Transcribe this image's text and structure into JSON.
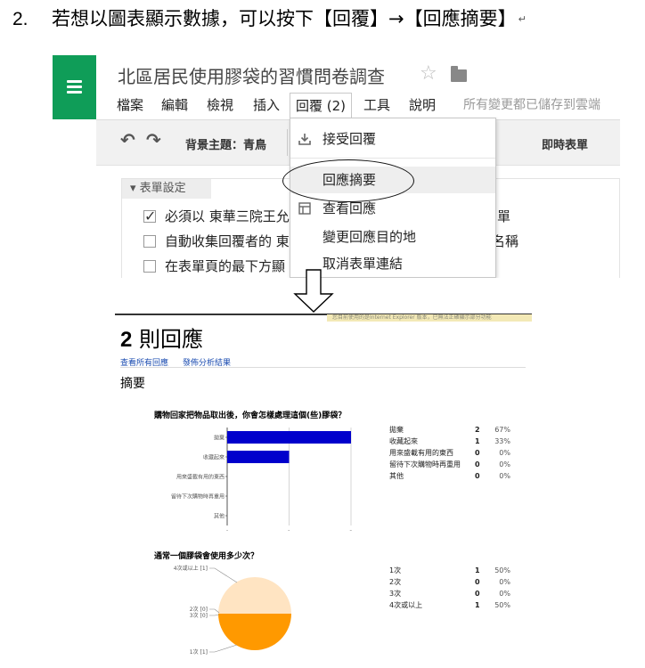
{
  "instruction": {
    "number": "2.",
    "text": "若想以圖表顯示數據，可以按下【回覆】→【回應摘要】",
    "return_mark": "↵"
  },
  "forms_window": {
    "title": "北區居民使用膠袋的習慣問卷調查",
    "icons": [
      "menu-icon",
      "star-icon",
      "folder-icon",
      "undo-icon",
      "redo-icon",
      "accept-responses-icon",
      "view-responses-icon"
    ],
    "menu": [
      "檔案",
      "編輯",
      "檢視",
      "插入",
      "回覆 (2)",
      "工具",
      "說明"
    ],
    "save_status": "所有變更都已儲存到雲端",
    "toolbar": {
      "theme_label": "背景主題：青鳥",
      "send_form_label": "即時表單"
    },
    "form_settings": {
      "header": "表單設定",
      "rows": [
        {
          "text": "必須以 東華三院王允",
          "tail": "單",
          "checked": true
        },
        {
          "text": "自動收集回覆者的 東",
          "tail": "名稱",
          "checked": false
        },
        {
          "text": "在表單頁的最下方顯",
          "tail": "",
          "checked": false
        }
      ]
    },
    "responses_dropdown": {
      "items": [
        "接受回覆",
        "回應摘要",
        "查看回應",
        "變更回應目的地",
        "取消表單連結"
      ],
      "highlighted": "回應摘要"
    }
  },
  "summary": {
    "notice": "您目前使用的是Internet Explorer 版本，已無法正確顯示部分功能",
    "count_number": "2",
    "count_text": " 則回應",
    "link_view_all": "查看所有回應",
    "link_publish": "發佈分析結果",
    "summary_label": "摘要",
    "questions": [
      {
        "title": "購物回家把物品取出後，你會怎樣處理這個(些)膠袋？",
        "stats": [
          {
            "label": "拋棄",
            "count": "2",
            "percent": "67%"
          },
          {
            "label": "收藏起來",
            "count": "1",
            "percent": "33%"
          },
          {
            "label": "用來盛載有用的東西",
            "count": "0",
            "percent": "0%"
          },
          {
            "label": "留待下次購物時再重用",
            "count": "0",
            "percent": "0%"
          },
          {
            "label": "其他",
            "count": "0",
            "percent": "0%"
          }
        ]
      },
      {
        "title": "通常一個膠袋會使用多少次？",
        "stats": [
          {
            "label": "1次",
            "count": "1",
            "percent": "50%"
          },
          {
            "label": "2次",
            "count": "0",
            "percent": "0%"
          },
          {
            "label": "3次",
            "count": "0",
            "percent": "0%"
          },
          {
            "label": "4次或以上",
            "count": "1",
            "percent": "50%"
          }
        ]
      }
    ]
  },
  "chart_data": [
    {
      "type": "bar",
      "orientation": "horizontal",
      "categories": [
        "拋棄",
        "收藏起來",
        "用來盛載有用的東西",
        "留待下次購物時再重用",
        "其他"
      ],
      "values": [
        2,
        1,
        0,
        0,
        0
      ],
      "xlim": [
        0,
        2
      ],
      "xticks": [
        "0",
        "1",
        "2"
      ],
      "bar_color": "#0000cc",
      "grid": true
    },
    {
      "type": "pie",
      "labels": [
        "4次或以上 [1]",
        "2次 [0]",
        "3次 [0]",
        "1次 [1]"
      ],
      "values": [
        1,
        0,
        0,
        1
      ],
      "colors": [
        "#ffe4c2",
        "#ff9900"
      ]
    }
  ]
}
